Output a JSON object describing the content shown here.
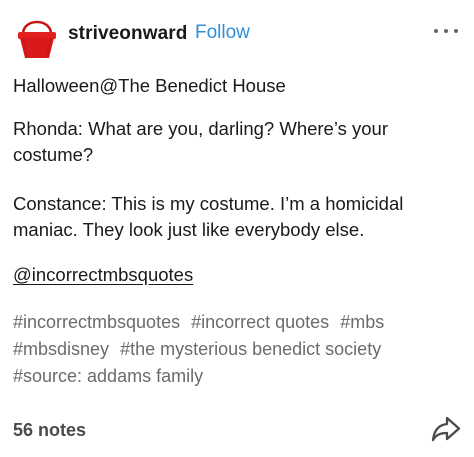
{
  "post": {
    "username": "striveonward",
    "follow_label": "Follow",
    "avatar_icon": "red-bucket-icon",
    "more_icon": "more-options-icon",
    "title": "Halloween@The Benedict House",
    "line_rhonda": "Rhonda: What are you, darling? Where’s your costume?",
    "line_constance": "Constance: This is my costume. I’m a homicidal maniac. They look just like everybody else.",
    "mention": "@incorrectmbsquotes",
    "tags": [
      "#incorrectmbsquotes",
      "#incorrect quotes",
      "#mbs",
      "#mbsdisney",
      "#the mysterious benedict society",
      "#source: addams family"
    ],
    "notes": "56 notes",
    "share_icon": "share-arrow-icon"
  },
  "colors": {
    "follow": "#2f8fd8",
    "tag": "#6b6b6b",
    "avatar": "#d91a1a"
  }
}
